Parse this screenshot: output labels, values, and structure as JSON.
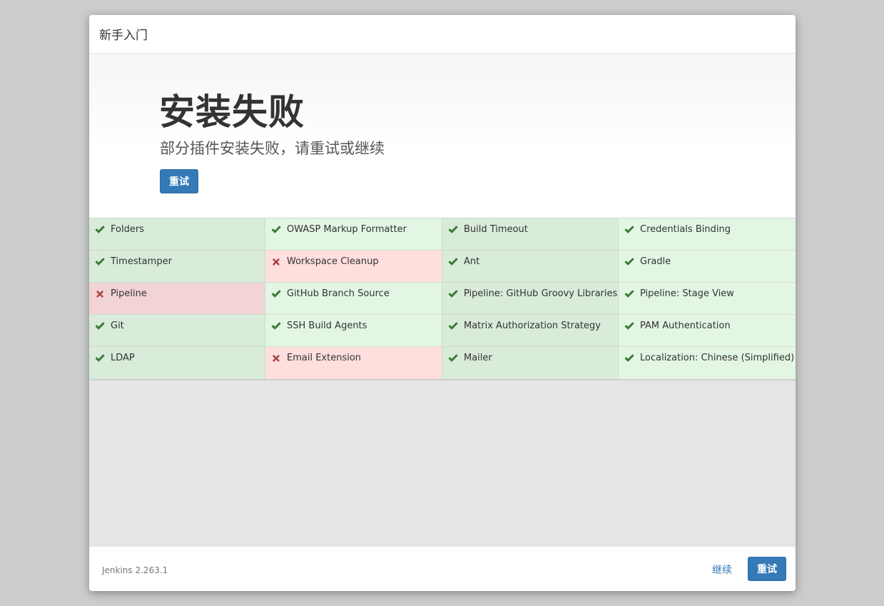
{
  "header": {
    "title": "新手入门"
  },
  "hero": {
    "title": "安装失败",
    "subtitle": "部分插件安装失败，请重试或继续",
    "retry_label": "重试"
  },
  "colors": {
    "success_icon": "#3c763d",
    "fail_icon": "#a94442",
    "primary": "#337ab7"
  },
  "plugins": [
    {
      "name": "Folders",
      "status": "success"
    },
    {
      "name": "OWASP Markup Formatter",
      "status": "success"
    },
    {
      "name": "Build Timeout",
      "status": "success"
    },
    {
      "name": "Credentials Binding",
      "status": "success"
    },
    {
      "name": "Timestamper",
      "status": "success"
    },
    {
      "name": "Workspace Cleanup",
      "status": "failed"
    },
    {
      "name": "Ant",
      "status": "success"
    },
    {
      "name": "Gradle",
      "status": "success"
    },
    {
      "name": "Pipeline",
      "status": "failed"
    },
    {
      "name": "GitHub Branch Source",
      "status": "success"
    },
    {
      "name": "Pipeline: GitHub Groovy Libraries",
      "status": "success"
    },
    {
      "name": "Pipeline: Stage View",
      "status": "success"
    },
    {
      "name": "Git",
      "status": "success"
    },
    {
      "name": "SSH Build Agents",
      "status": "success"
    },
    {
      "name": "Matrix Authorization Strategy",
      "status": "success"
    },
    {
      "name": "PAM Authentication",
      "status": "success"
    },
    {
      "name": "LDAP",
      "status": "success"
    },
    {
      "name": "Email Extension",
      "status": "failed"
    },
    {
      "name": "Mailer",
      "status": "success"
    },
    {
      "name": "Localization: Chinese (Simplified)",
      "status": "success"
    }
  ],
  "footer": {
    "version": "Jenkins 2.263.1",
    "continue_label": "继续",
    "retry_label": "重试"
  }
}
